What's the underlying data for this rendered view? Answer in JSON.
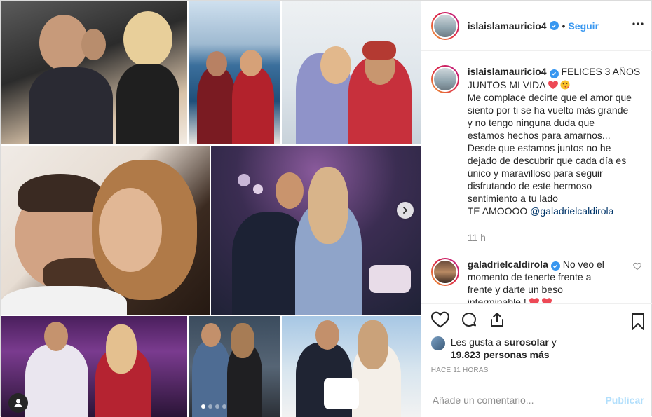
{
  "post": {
    "author": {
      "username": "islaislamauricio4",
      "verified": true,
      "follow_label": "Seguir",
      "separator": "•"
    },
    "caption": {
      "username": "islaislamauricio4",
      "lines": [
        "FELICES 3 AÑOS",
        "JUNTOS MI VIDA",
        "Me complace decirte que el amor que",
        "siento por ti se ha vuelto más grande",
        "y no tengo ninguna duda que",
        "estamos hechos para amarnos...",
        "Desde que estamos juntos no he",
        "dejado de descubrir que cada día es",
        "único y maravilloso para seguir",
        "disfrutando de este hermoso",
        "sentimiento a tu lado",
        "TE AMOOOO"
      ],
      "mention": "@galadrielcaldirola",
      "time": "11 h"
    },
    "comments": [
      {
        "username": "galadrielcaldirola",
        "verified": true,
        "text_lines": [
          "No veo el",
          "momento de tenerte frente a",
          "frente y darte un beso",
          "interminable !"
        ]
      }
    ],
    "likes": {
      "prefix": "Les gusta a",
      "user": "surosolar",
      "conjunction": "y",
      "count_text": "19.823 personas más"
    },
    "posted_ago": "HACE 11 HORAS",
    "comment_input": {
      "placeholder": "Añade un comentario...",
      "submit_label": "Publicar"
    },
    "carousel": {
      "slides": 4,
      "active_index": 0
    }
  },
  "colors": {
    "accent": "#3897f0",
    "text": "#262626",
    "muted": "#8e8e8e",
    "heart_red": "#ed4956",
    "publish_disabled": "#b2dffc"
  },
  "icons": {
    "more": "more-options-icon",
    "like": "heart-icon",
    "comment": "comment-icon",
    "share": "share-icon",
    "save": "bookmark-icon",
    "next": "chevron-right-icon",
    "tag": "user-tag-icon"
  }
}
